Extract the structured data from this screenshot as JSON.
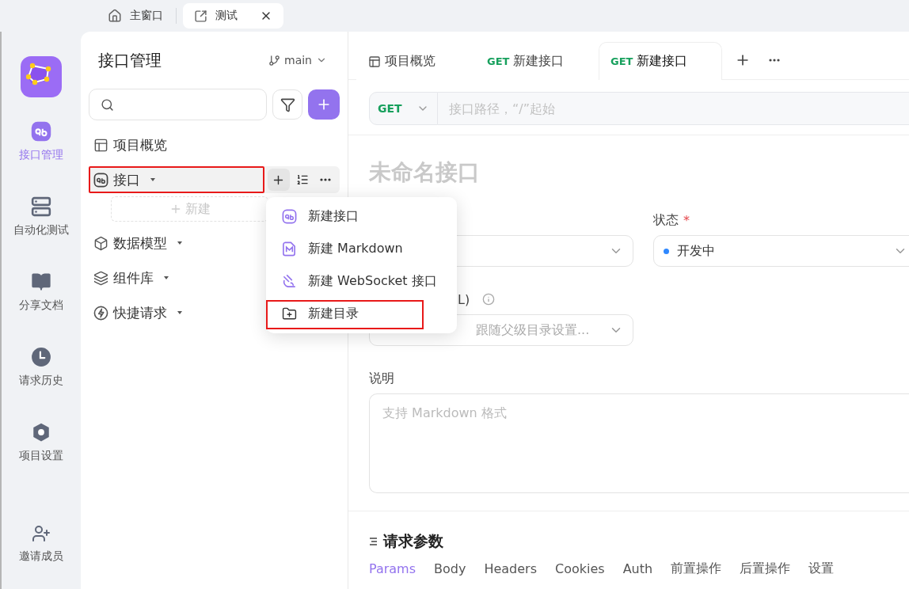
{
  "window_tabs": [
    {
      "kind": "home",
      "label": "主窗口",
      "selected": false
    },
    {
      "kind": "external",
      "label": "测试",
      "selected": true
    }
  ],
  "rail": {
    "items": [
      {
        "kind": "api",
        "label": "接口管理",
        "selected": true
      },
      {
        "kind": "server",
        "label": "自动化测试",
        "selected": false
      },
      {
        "kind": "book",
        "label": "分享文档",
        "selected": false
      },
      {
        "kind": "clock",
        "label": "请求历史",
        "selected": false
      },
      {
        "kind": "hexagon",
        "label": "项目设置",
        "selected": false
      }
    ],
    "invite": "邀请成员"
  },
  "sidebar": {
    "title": "接口管理",
    "branch": "main",
    "tree": [
      {
        "kind": "overview",
        "label": "项目概览",
        "has_caret": false,
        "hovered": false,
        "highlighted": false
      },
      {
        "kind": "api",
        "label": "接口",
        "has_caret": true,
        "hovered": true,
        "highlighted": true,
        "new_label": "新建"
      },
      {
        "kind": "box",
        "label": "数据模型",
        "has_caret": true,
        "hovered": false,
        "highlighted": false
      },
      {
        "kind": "layers",
        "label": "组件库",
        "has_caret": true,
        "hovered": false,
        "highlighted": false
      },
      {
        "kind": "zap",
        "label": "快捷请求",
        "has_caret": true,
        "hovered": false,
        "highlighted": false
      }
    ]
  },
  "context_menu": {
    "items": [
      {
        "kind": "api",
        "label": "新建接口",
        "highlighted": false
      },
      {
        "kind": "markdown",
        "label": "新建 Markdown",
        "highlighted": false
      },
      {
        "kind": "websocket",
        "label": "新建 WebSocket 接口",
        "highlighted": false
      },
      {
        "kind": "folder",
        "label": "新建目录",
        "highlighted": true
      }
    ]
  },
  "editor": {
    "tabs": [
      {
        "kind": "overview",
        "label": "项目概览",
        "selected": false
      },
      {
        "kind": "request",
        "method": "GET",
        "label": "新建接口",
        "selected": false
      },
      {
        "kind": "request",
        "method": "GET",
        "label": "新建接口",
        "selected": true
      }
    ],
    "method": "GET",
    "path_placeholder": "接口路径，“/”起始",
    "name_placeholder": "未命名接口",
    "status": {
      "label": "状态",
      "required_mark": "*",
      "value": "开发中",
      "color": "#2f88ff"
    },
    "server": {
      "label": "L)",
      "placeholder": "跟随父级目录设置..."
    },
    "description": {
      "label": "说明",
      "placeholder": "支持 Markdown 格式"
    },
    "params": {
      "title": "请求参数",
      "tabs": [
        {
          "label": "Params",
          "selected": true
        },
        {
          "label": "Body",
          "selected": false
        },
        {
          "label": "Headers",
          "selected": false
        },
        {
          "label": "Cookies",
          "selected": false
        },
        {
          "label": "Auth",
          "selected": false
        },
        {
          "label": "前置操作",
          "selected": false
        },
        {
          "label": "后置操作",
          "selected": false
        },
        {
          "label": "设置",
          "selected": false
        }
      ]
    }
  }
}
